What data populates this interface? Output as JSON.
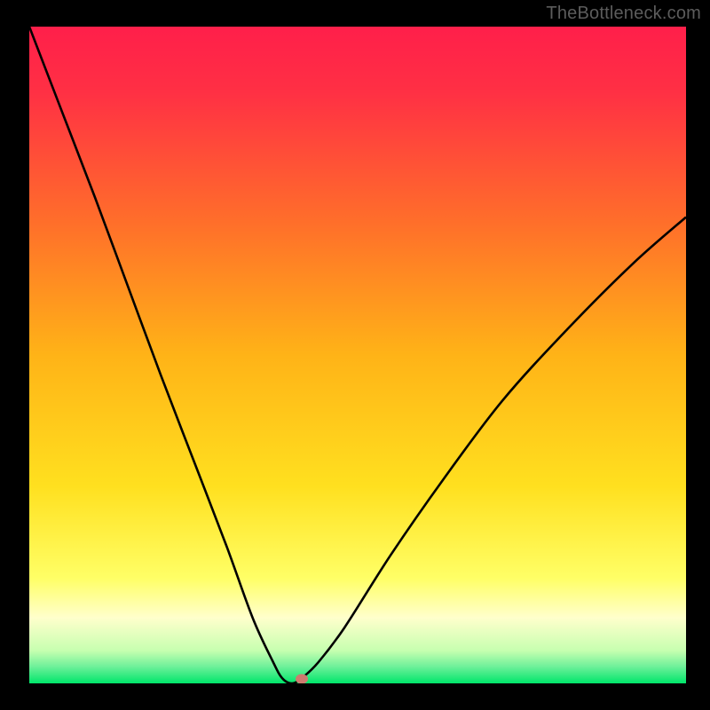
{
  "watermark": "TheBottleneck.com",
  "colors": {
    "frame": "#000000",
    "watermark_text": "#5c5c5c",
    "curve_stroke": "#000000",
    "marker_fill": "#cd7b6f",
    "gradient_top": "#ff1f4a",
    "gradient_mid_upper": "#ff8a1f",
    "gradient_mid": "#ffe01f",
    "gradient_pale": "#ffffbb",
    "gradient_bottom": "#00e66a"
  },
  "chart_data": {
    "type": "line",
    "title": "",
    "xlabel": "",
    "ylabel": "",
    "xlim": [
      0,
      100
    ],
    "ylim": [
      0,
      100
    ],
    "grid": false,
    "legend": false,
    "series": [
      {
        "name": "bottleneck-curve",
        "x": [
          0,
          5,
          10,
          15,
          20,
          25,
          30,
          34,
          37,
          38.5,
          40,
          41.5,
          44,
          48,
          55,
          63,
          72,
          82,
          92,
          100
        ],
        "y": [
          100,
          87,
          74,
          60.5,
          47,
          34,
          21,
          10,
          3.5,
          0.8,
          0,
          0.8,
          3.2,
          8.5,
          19.5,
          31,
          43,
          54,
          64,
          71
        ]
      }
    ],
    "marker": {
      "x": 41.5,
      "y": 0.7
    },
    "background_gradient_stops": [
      {
        "pos": 0.0,
        "color": "#ff1f4a"
      },
      {
        "pos": 0.1,
        "color": "#ff3044"
      },
      {
        "pos": 0.3,
        "color": "#ff6f2a"
      },
      {
        "pos": 0.5,
        "color": "#ffb317"
      },
      {
        "pos": 0.7,
        "color": "#ffe01f"
      },
      {
        "pos": 0.84,
        "color": "#ffff66"
      },
      {
        "pos": 0.9,
        "color": "#ffffcc"
      },
      {
        "pos": 0.95,
        "color": "#c7ffb0"
      },
      {
        "pos": 0.975,
        "color": "#6cf099"
      },
      {
        "pos": 1.0,
        "color": "#00e66a"
      }
    ]
  }
}
